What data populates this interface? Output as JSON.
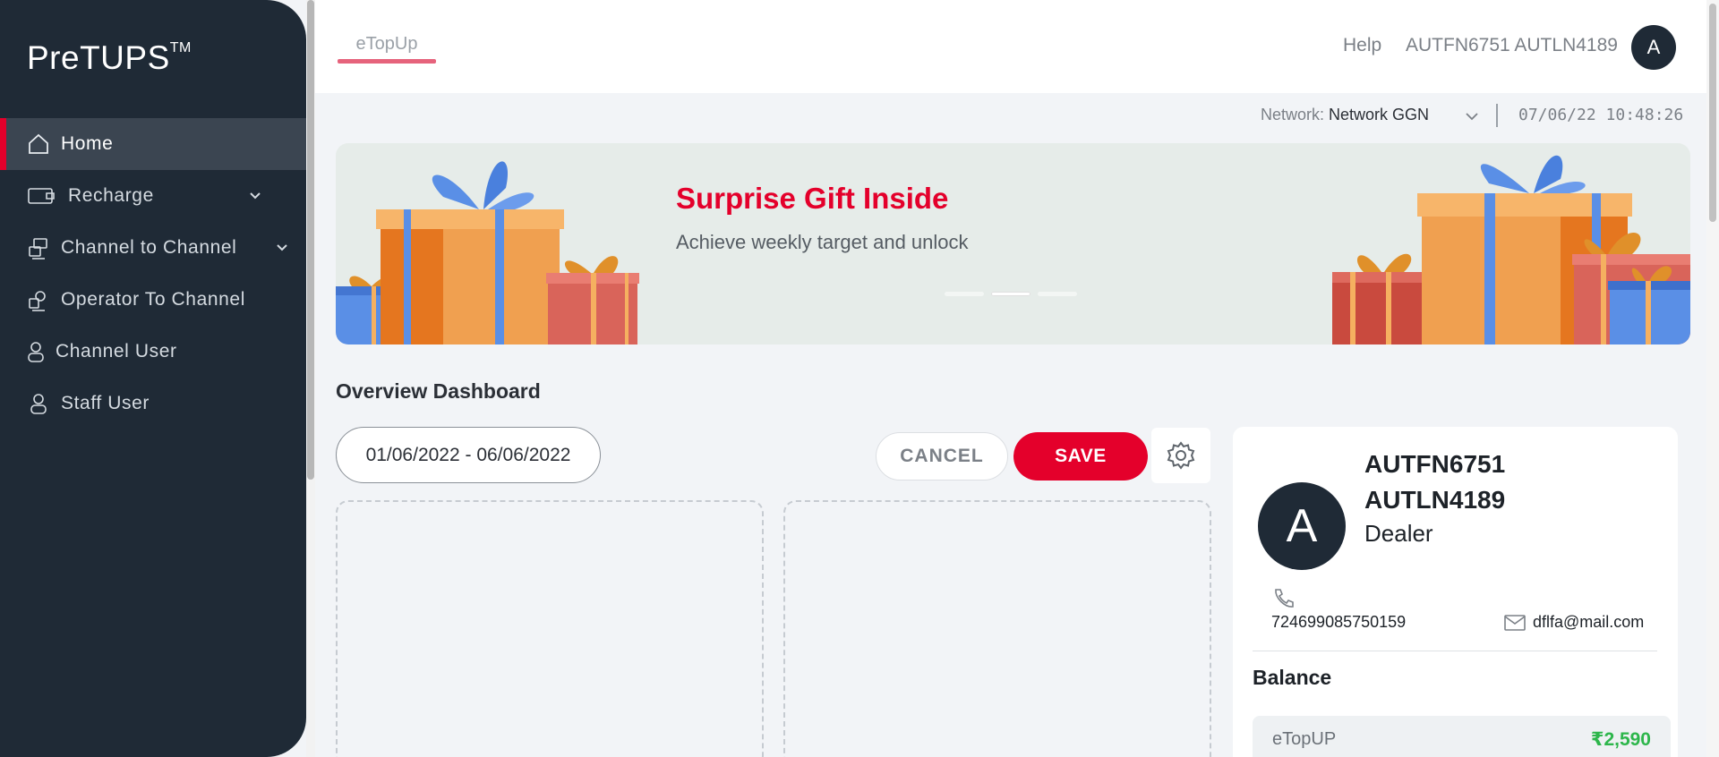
{
  "app": {
    "logo": "PreTUPS",
    "logo_tm": "TM"
  },
  "sidebar": {
    "items": [
      {
        "label": "Home",
        "icon": "home-icon",
        "active": true
      },
      {
        "label": "Recharge",
        "icon": "recharge-icon",
        "has_chevron": true
      },
      {
        "label": "Channel to Channel",
        "icon": "channel-transfer-icon",
        "has_chevron": true
      },
      {
        "label": "Operator To Channel",
        "icon": "operator-channel-icon"
      },
      {
        "label": "Channel User",
        "icon": "user-icon"
      },
      {
        "label": "Staff User",
        "icon": "user-icon"
      }
    ]
  },
  "header": {
    "tab": "eTopUp",
    "help": "Help",
    "username": "AUTFN6751 AUTLN4189",
    "avatar_initial": "A"
  },
  "network": {
    "label": "Network:",
    "value": "Network GGN",
    "datetime": "07/06/22 10:48:26"
  },
  "banner": {
    "title": "Surprise Gift Inside",
    "subtitle": "Achieve weekly target and unlock",
    "slides": 3,
    "active_slide": 2
  },
  "dashboard": {
    "title": "Overview Dashboard",
    "date_range": "01/06/2022 - 06/06/2022",
    "cancel_label": "CANCEL",
    "save_label": "SAVE"
  },
  "profile": {
    "avatar_initial": "A",
    "name": "AUTFN6751 AUTLN4189",
    "role": "Dealer",
    "phone": "724699085750159",
    "email": "dflfa@mail.com",
    "balance_title": "Balance",
    "balance_label": "eTopUP",
    "balance_value": "₹2,590"
  },
  "colors": {
    "accent": "#e4002b",
    "sidebar": "#1f2a36",
    "balance": "#2db64b"
  }
}
